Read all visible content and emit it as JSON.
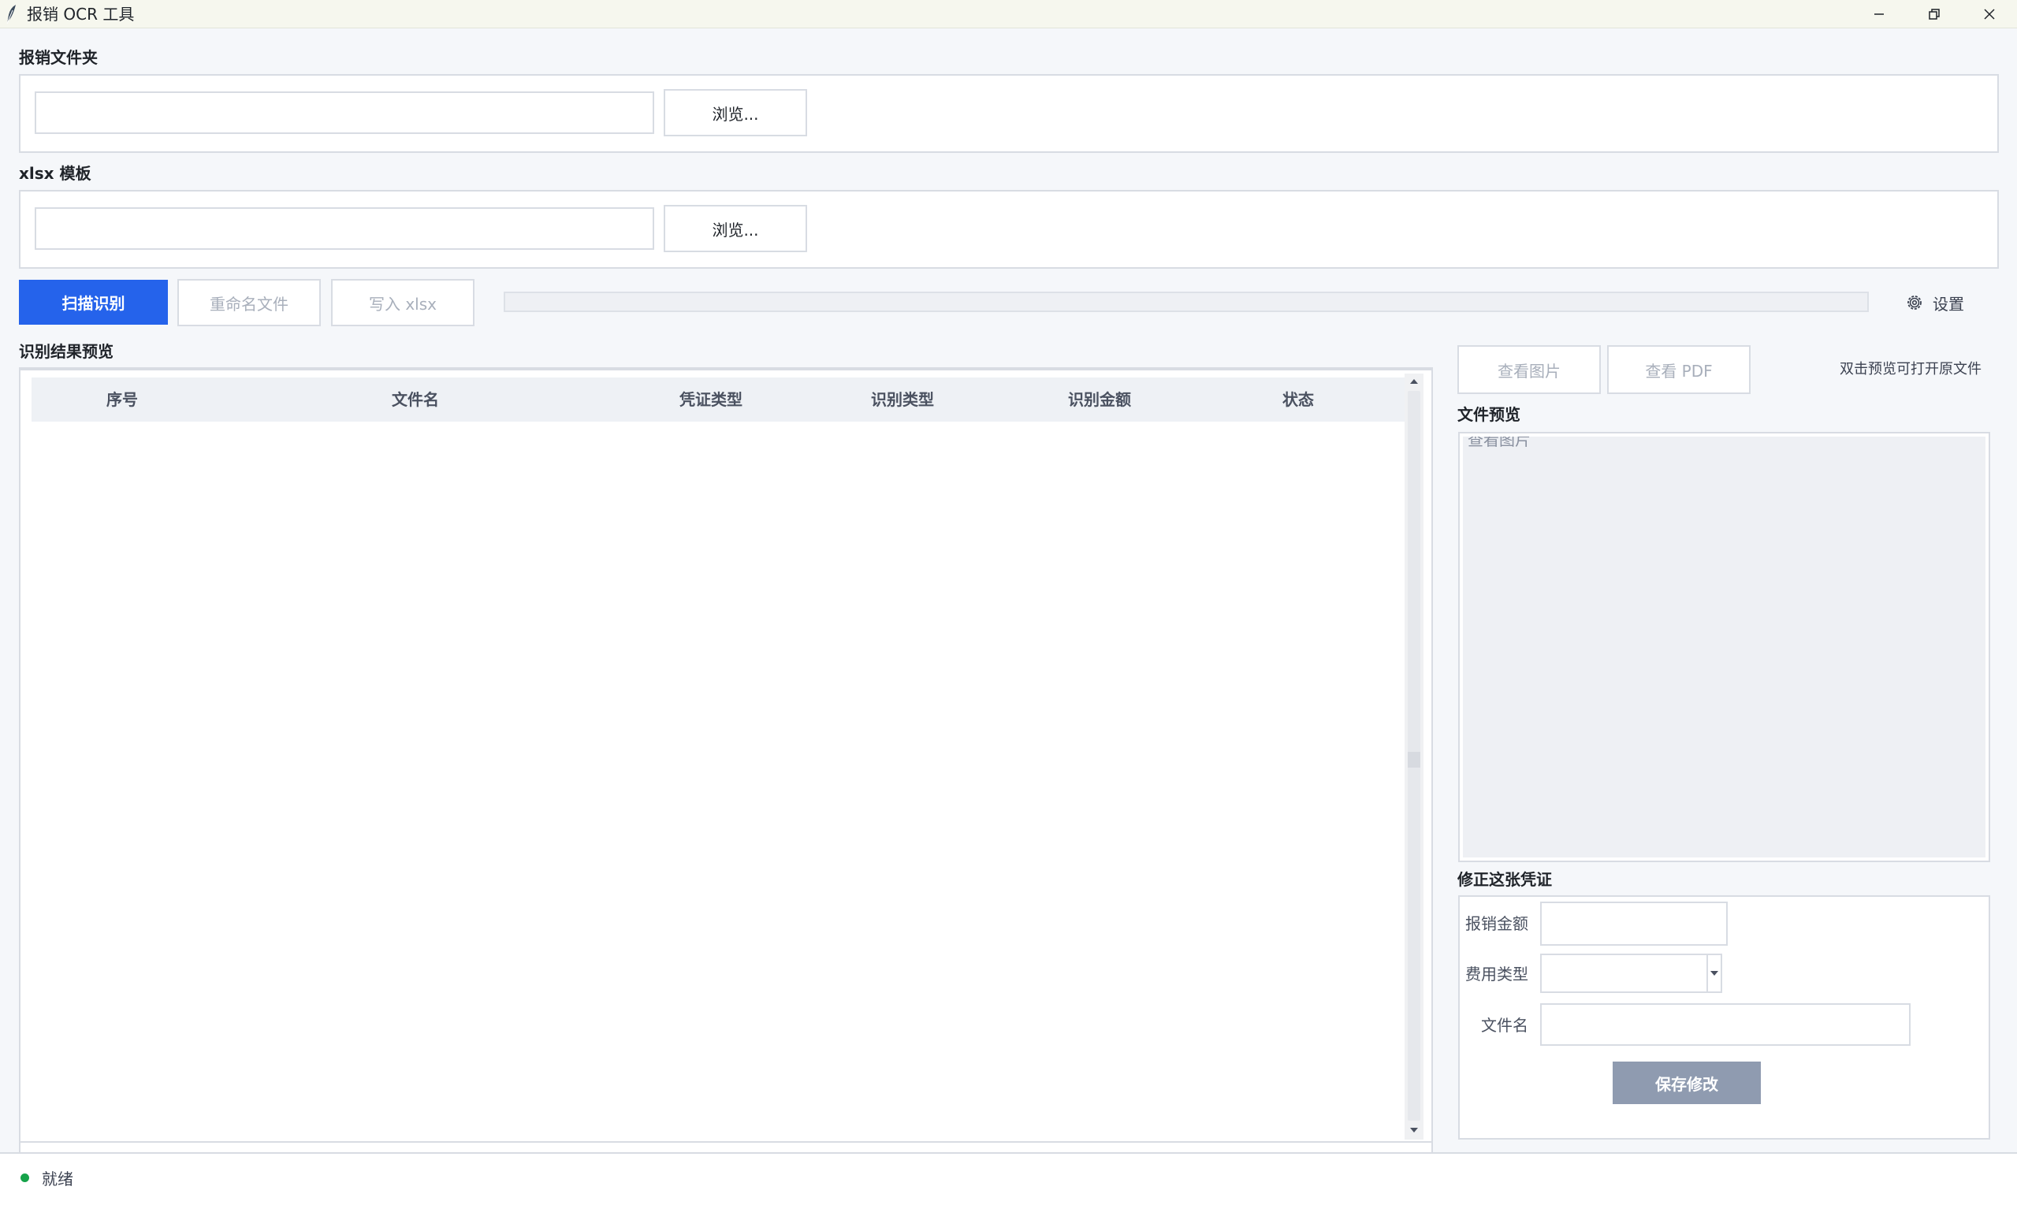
{
  "window": {
    "title": "报销 OCR 工具"
  },
  "folder_section": {
    "label": "报销文件夹",
    "path_value": "",
    "browse_label": "浏览..."
  },
  "template_section": {
    "label": "xlsx 模板",
    "path_value": "",
    "browse_label": "浏览..."
  },
  "actions": {
    "scan_label": "扫描识别",
    "rename_label": "重命名文件",
    "write_label": "写入 xlsx",
    "progress": 0,
    "settings_label": "设置"
  },
  "results": {
    "label": "识别结果预览",
    "columns": [
      "序号",
      "文件名",
      "凭证类型",
      "识别类型",
      "识别金额",
      "状态"
    ],
    "rows": []
  },
  "preview": {
    "view_image_label": "查看图片",
    "view_pdf_label": "查看 PDF",
    "hint": "双击预览可打开原文件",
    "label": "文件预览",
    "placeholder": "查看图片"
  },
  "correction": {
    "label": "修正这张凭证",
    "amount_label": "报销金额",
    "amount_value": "",
    "type_label": "费用类型",
    "type_value": "",
    "filename_label": "文件名",
    "filename_value": "",
    "save_label": "保存修改"
  },
  "status": {
    "text": "就绪",
    "dot_color": "#16a34a"
  },
  "colors": {
    "primary": "#2563eb",
    "save_button": "#8f9bb0"
  },
  "icons": {
    "app": "feather-icon",
    "minimize": "minimize-icon",
    "restore": "restore-icon",
    "close": "close-icon",
    "settings": "gear-icon",
    "scroll_up": "triangle-up-icon",
    "scroll_down": "triangle-down-icon",
    "dropdown": "chevron-down-icon"
  }
}
